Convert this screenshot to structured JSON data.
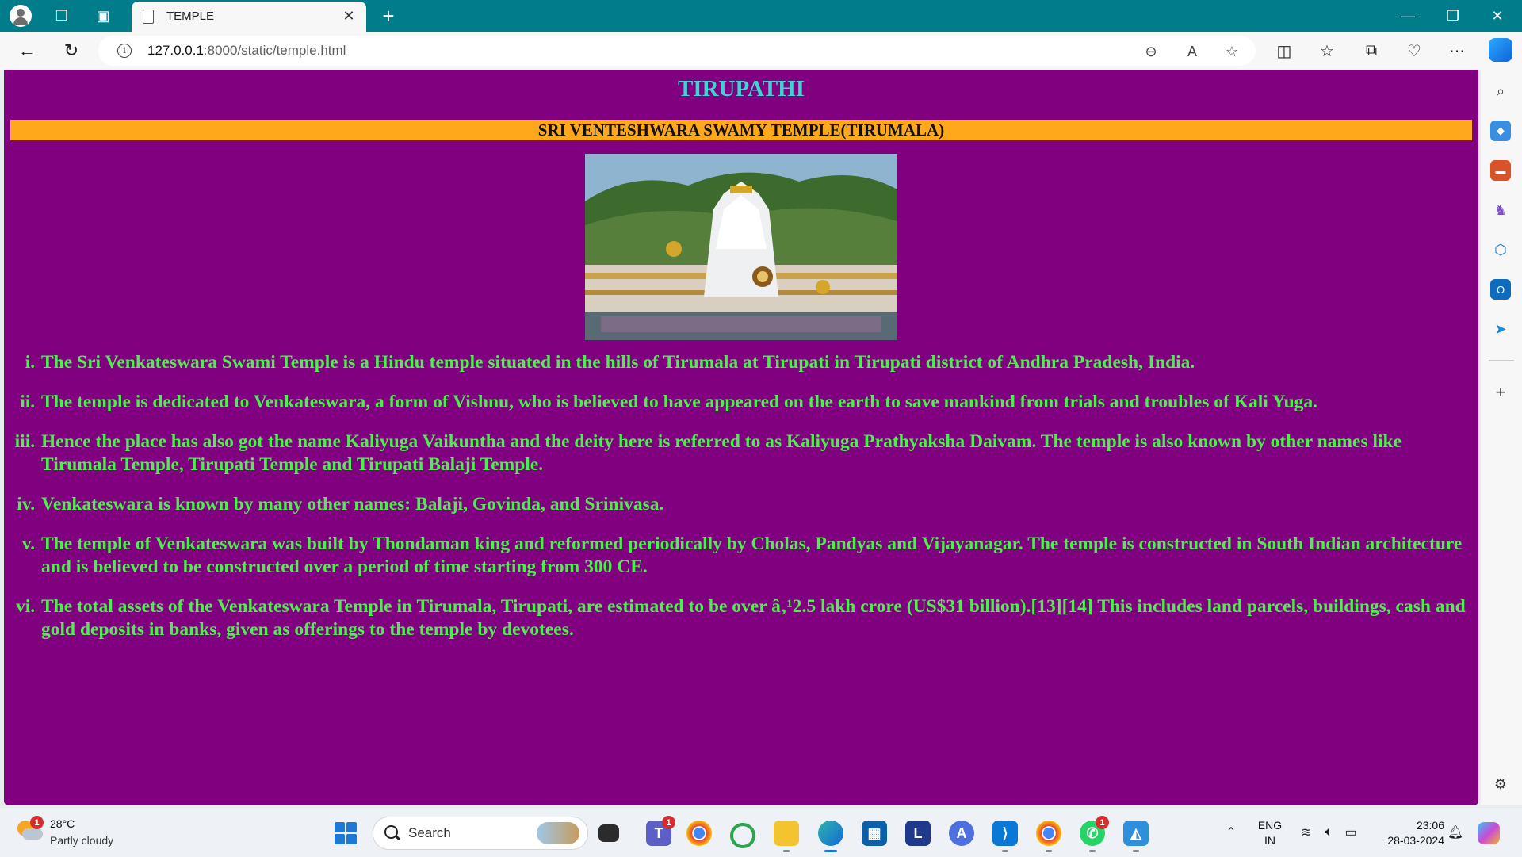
{
  "browser": {
    "tab_title": "TEMPLE",
    "url_host": "127.0.0.1",
    "url_path": ":8000/static/temple.html"
  },
  "page": {
    "heading": "TIRUPATHI",
    "banner": "SRI VENTESHWARA SWAMY TEMPLE(TIRUMALA)",
    "facts": [
      "The Sri Venkateswara Swami Temple is a Hindu temple situated in the hills of Tirumala at Tirupati in Tirupati district of Andhra Pradesh, India.",
      "The temple is dedicated to Venkateswara, a form of Vishnu, who is believed to have appeared on the earth to save mankind from trials and troubles of Kali Yuga.",
      "Hence the place has also got the name Kaliyuga Vaikuntha and the deity here is referred to as Kaliyuga Prathyaksha Daivam. The temple is also known by other names like Tirumala Temple, Tirupati Temple and Tirupati Balaji Temple.",
      "Venkateswara is known by many other names: Balaji, Govinda, and Srinivasa.",
      "The temple of Venkateswara was built by Thondaman king and reformed periodically by Cholas, Pandyas and Vijayanagar. The temple is constructed in South Indian architecture and is believed to be constructed over a period of time starting from 300 CE.",
      "The total assets of the Venkateswara Temple in Tirumala, Tirupati, are estimated to be over â‚¹2.5 lakh crore (US$31 billion).[13][14] This includes land parcels, buildings, cash and gold deposits in banks, given as offerings to the temple by devotees."
    ],
    "colors": {
      "background": "#800080",
      "heading": "#3fd4d4",
      "banner_bg": "#ffa81c",
      "list_text": "#4cf04c"
    }
  },
  "taskbar": {
    "weather_temp": "28°C",
    "weather_desc": "Partly cloudy",
    "weather_badge": "1",
    "search_label": "Search",
    "teams_badge": "1",
    "whatsapp_badge": "1",
    "language_line1": "ENG",
    "language_line2": "IN",
    "time": "23:06",
    "date": "28-03-2024"
  }
}
